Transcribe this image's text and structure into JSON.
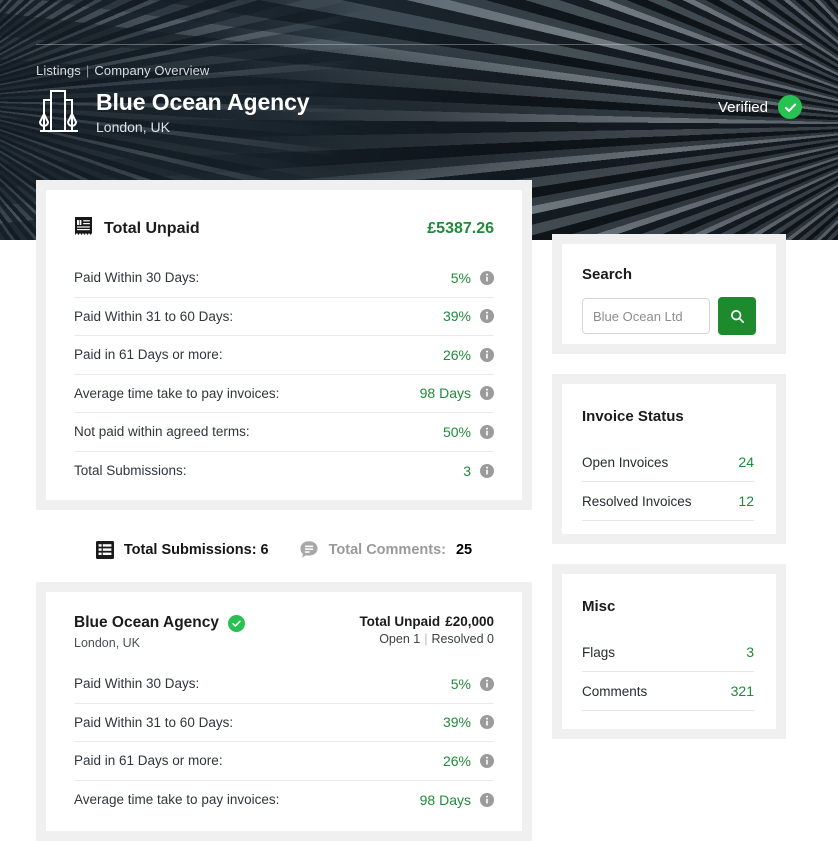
{
  "hero": {
    "breadcrumb": {
      "root": "Listings",
      "separator": "|",
      "current": "Company Overview"
    },
    "company_name": "Blue Ocean Agency",
    "company_location": "London, UK",
    "verified_label": "Verified",
    "logo_icon": "building-icon",
    "verified_icon": "check-circle-icon"
  },
  "summary_card": {
    "icon": "receipt-icon",
    "title": "Total Unpaid",
    "amount": "£5387.26",
    "metrics": [
      {
        "label": "Paid Within 30 Days:",
        "value": "5%",
        "info_icon": "info-icon"
      },
      {
        "label": "Paid Within 31 to 60 Days:",
        "value": "39%",
        "info_icon": "info-icon"
      },
      {
        "label": "Paid in 61 Days or more:",
        "value": "26%",
        "info_icon": "info-icon"
      },
      {
        "label": "Average time take to pay invoices:",
        "value": "98 Days",
        "info_icon": "info-icon"
      },
      {
        "label": "Not paid within agreed terms:",
        "value": "50%",
        "info_icon": "info-icon"
      },
      {
        "label": "Total Submissions:",
        "value": "3",
        "info_icon": "info-icon"
      }
    ]
  },
  "totals_strip": {
    "submissions_icon": "list-icon",
    "submissions_label": "Total Submissions: 6",
    "comments_icon": "comment-icon",
    "comments_label": "Total Comments:",
    "comments_count": "25"
  },
  "submission_card": {
    "name": "Blue Ocean Agency",
    "verified_icon": "check-circle-icon",
    "location": "London, UK",
    "unpaid_label": "Total Unpaid",
    "unpaid_amount": "£20,000",
    "open_label": "Open 1",
    "counts_separator": "|",
    "resolved_label": "Resolved 0",
    "metrics": [
      {
        "label": "Paid Within 30 Days:",
        "value": "5%",
        "info_icon": "info-icon"
      },
      {
        "label": "Paid Within 31 to 60 Days:",
        "value": "39%",
        "info_icon": "info-icon"
      },
      {
        "label": "Paid in 61 Days or more:",
        "value": "26%",
        "info_icon": "info-icon"
      },
      {
        "label": "Average time take to pay invoices:",
        "value": "98 Days",
        "info_icon": "info-icon"
      }
    ]
  },
  "sidebar": {
    "search": {
      "title": "Search",
      "placeholder": "Blue Ocean Ltd",
      "value": "",
      "button_icon": "search-icon"
    },
    "invoice_status": {
      "title": "Invoice Status",
      "rows": [
        {
          "label": "Open Invoices",
          "value": "24"
        },
        {
          "label": "Resolved Invoices",
          "value": "12"
        }
      ]
    },
    "misc": {
      "title": "Misc",
      "rows": [
        {
          "label": "Flags",
          "value": "3"
        },
        {
          "label": "Comments",
          "value": "321"
        }
      ]
    }
  },
  "colors": {
    "green_accent": "#1f8b3a",
    "green_button": "#1d8a2e",
    "verified_green": "#27c252",
    "hero_blue": "#2b3e4d",
    "card_frame": "#f0f0f0"
  }
}
